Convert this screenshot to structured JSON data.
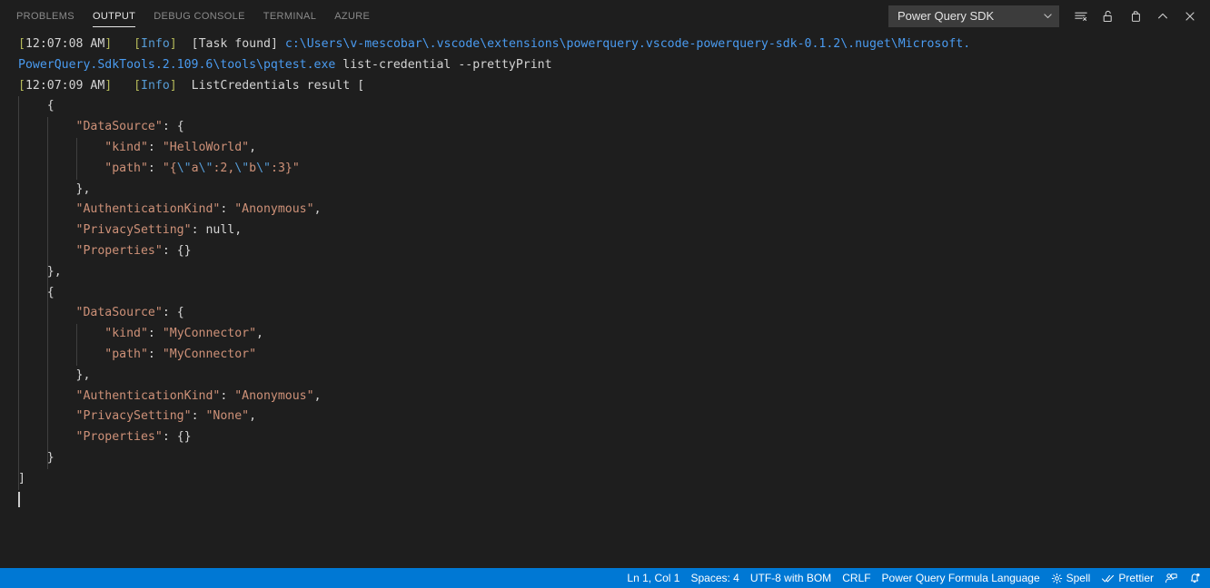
{
  "panel": {
    "tabs": [
      {
        "label": "PROBLEMS",
        "active": false
      },
      {
        "label": "OUTPUT",
        "active": true
      },
      {
        "label": "DEBUG CONSOLE",
        "active": false
      },
      {
        "label": "TERMINAL",
        "active": false
      },
      {
        "label": "AZURE",
        "active": false
      }
    ],
    "channel": {
      "value": "Power Query SDK",
      "chevron_icon": "chevron-down-icon"
    },
    "actions": [
      {
        "name": "clear-output-button",
        "icon": "clear-output-icon",
        "title": "Clear Output"
      },
      {
        "name": "turn-auto-scrolling-off-button",
        "icon": "unlock-icon",
        "title": "Turn Auto Scrolling Off"
      },
      {
        "name": "open-output-in-editor-button",
        "icon": "open-in-editor-icon",
        "title": "Open Output in Editor"
      },
      {
        "name": "maximize-panel-size-button",
        "icon": "chevron-up-icon",
        "title": "Maximize Panel Size"
      },
      {
        "name": "close-panel-button",
        "icon": "close-icon",
        "title": "Close Panel"
      }
    ]
  },
  "output": {
    "log_lines": [
      {
        "segments": [
          {
            "text": "[",
            "type": "bracket"
          },
          {
            "text": "12:07:08 AM",
            "type": "plain"
          },
          {
            "text": "]",
            "type": "bracket"
          },
          {
            "text": "   ",
            "type": "plain"
          },
          {
            "text": "[",
            "type": "bracket"
          },
          {
            "text": "Info",
            "type": "info"
          },
          {
            "text": "]",
            "type": "bracket"
          },
          {
            "text": "  ",
            "type": "plain"
          },
          {
            "text": "[Task found]",
            "type": "plain"
          },
          {
            "text": " ",
            "type": "plain"
          },
          {
            "text": "c:\\Users\\v-mescobar\\.vscode\\extensions\\powerquery.vscode-powerquery-sdk-0.1.2\\.nuget\\Microsoft.",
            "type": "path"
          }
        ]
      },
      {
        "segments": [
          {
            "text": "PowerQuery.SdkTools.2.109.6\\tools\\pqtest.exe",
            "type": "path"
          },
          {
            "text": " list-credential --prettyPrint",
            "type": "plain"
          }
        ]
      },
      {
        "segments": [
          {
            "text": "[",
            "type": "bracket"
          },
          {
            "text": "12:07:09 AM",
            "type": "plain"
          },
          {
            "text": "]",
            "type": "bracket"
          },
          {
            "text": "   ",
            "type": "plain"
          },
          {
            "text": "[",
            "type": "bracket"
          },
          {
            "text": "Info",
            "type": "info"
          },
          {
            "text": "]",
            "type": "bracket"
          },
          {
            "text": "  ",
            "type": "plain"
          },
          {
            "text": "ListCredentials result [",
            "type": "plain"
          }
        ]
      },
      {
        "segments": [
          {
            "text": "    {",
            "type": "punc"
          }
        ]
      },
      {
        "segments": [
          {
            "text": "        ",
            "type": "punc"
          },
          {
            "text": "\"DataSource\"",
            "type": "key"
          },
          {
            "text": ": {",
            "type": "punc"
          }
        ]
      },
      {
        "segments": [
          {
            "text": "            ",
            "type": "punc"
          },
          {
            "text": "\"kind\"",
            "type": "key"
          },
          {
            "text": ": ",
            "type": "punc"
          },
          {
            "text": "\"HelloWorld\"",
            "type": "str"
          },
          {
            "text": ",",
            "type": "punc"
          }
        ]
      },
      {
        "segments": [
          {
            "text": "            ",
            "type": "punc"
          },
          {
            "text": "\"path\"",
            "type": "key"
          },
          {
            "text": ": ",
            "type": "punc"
          },
          {
            "text": "\"{",
            "type": "str"
          },
          {
            "text": "\\\"",
            "type": "esc"
          },
          {
            "text": "a",
            "type": "str"
          },
          {
            "text": "\\\"",
            "type": "esc"
          },
          {
            "text": ":2,",
            "type": "str"
          },
          {
            "text": "\\\"",
            "type": "esc"
          },
          {
            "text": "b",
            "type": "str"
          },
          {
            "text": "\\\"",
            "type": "esc"
          },
          {
            "text": ":3}\"",
            "type": "str"
          }
        ]
      },
      {
        "segments": [
          {
            "text": "        },",
            "type": "punc"
          }
        ]
      },
      {
        "segments": [
          {
            "text": "        ",
            "type": "punc"
          },
          {
            "text": "\"AuthenticationKind\"",
            "type": "key"
          },
          {
            "text": ": ",
            "type": "punc"
          },
          {
            "text": "\"Anonymous\"",
            "type": "str"
          },
          {
            "text": ",",
            "type": "punc"
          }
        ]
      },
      {
        "segments": [
          {
            "text": "        ",
            "type": "punc"
          },
          {
            "text": "\"PrivacySetting\"",
            "type": "key"
          },
          {
            "text": ": ",
            "type": "punc"
          },
          {
            "text": "null",
            "type": "null"
          },
          {
            "text": ",",
            "type": "punc"
          }
        ]
      },
      {
        "segments": [
          {
            "text": "        ",
            "type": "punc"
          },
          {
            "text": "\"Properties\"",
            "type": "key"
          },
          {
            "text": ": {}",
            "type": "punc"
          }
        ]
      },
      {
        "segments": [
          {
            "text": "    },",
            "type": "punc"
          }
        ]
      },
      {
        "segments": [
          {
            "text": "    {",
            "type": "punc"
          }
        ]
      },
      {
        "segments": [
          {
            "text": "        ",
            "type": "punc"
          },
          {
            "text": "\"DataSource\"",
            "type": "key"
          },
          {
            "text": ": {",
            "type": "punc"
          }
        ]
      },
      {
        "segments": [
          {
            "text": "            ",
            "type": "punc"
          },
          {
            "text": "\"kind\"",
            "type": "key"
          },
          {
            "text": ": ",
            "type": "punc"
          },
          {
            "text": "\"MyConnector\"",
            "type": "str"
          },
          {
            "text": ",",
            "type": "punc"
          }
        ]
      },
      {
        "segments": [
          {
            "text": "            ",
            "type": "punc"
          },
          {
            "text": "\"path\"",
            "type": "key"
          },
          {
            "text": ": ",
            "type": "punc"
          },
          {
            "text": "\"MyConnector\"",
            "type": "str"
          }
        ]
      },
      {
        "segments": [
          {
            "text": "        },",
            "type": "punc"
          }
        ]
      },
      {
        "segments": [
          {
            "text": "        ",
            "type": "punc"
          },
          {
            "text": "\"AuthenticationKind\"",
            "type": "key"
          },
          {
            "text": ": ",
            "type": "punc"
          },
          {
            "text": "\"Anonymous\"",
            "type": "str"
          },
          {
            "text": ",",
            "type": "punc"
          }
        ]
      },
      {
        "segments": [
          {
            "text": "        ",
            "type": "punc"
          },
          {
            "text": "\"PrivacySetting\"",
            "type": "key"
          },
          {
            "text": ": ",
            "type": "punc"
          },
          {
            "text": "\"None\"",
            "type": "str"
          },
          {
            "text": ",",
            "type": "punc"
          }
        ]
      },
      {
        "segments": [
          {
            "text": "        ",
            "type": "punc"
          },
          {
            "text": "\"Properties\"",
            "type": "key"
          },
          {
            "text": ": {}",
            "type": "punc"
          }
        ]
      },
      {
        "segments": [
          {
            "text": "    }",
            "type": "punc"
          }
        ]
      },
      {
        "segments": [
          {
            "text": "]",
            "type": "punc"
          }
        ]
      },
      {
        "segments": []
      }
    ]
  },
  "status_bar": {
    "items": [
      {
        "name": "editor-position",
        "label": "Ln 1, Col 1",
        "icon": null
      },
      {
        "name": "editor-indentation",
        "label": "Spaces: 4",
        "icon": null
      },
      {
        "name": "editor-encoding",
        "label": "UTF-8 with BOM",
        "icon": null
      },
      {
        "name": "editor-eol",
        "label": "CRLF",
        "icon": null
      },
      {
        "name": "editor-language",
        "label": "Power Query Formula Language",
        "icon": null
      },
      {
        "name": "spell-checker",
        "label": "Spell",
        "icon": "gear-icon"
      },
      {
        "name": "prettier",
        "label": "Prettier",
        "icon": "double-check-icon"
      },
      {
        "name": "feedback",
        "label": "",
        "icon": "feedback-person-icon"
      },
      {
        "name": "notifications",
        "label": "",
        "icon": "bell-dot-icon"
      }
    ]
  },
  "colors": {
    "panel_background": "#1e1e1e",
    "status_bar_background": "#0078d4",
    "accent_text": "#ffffff",
    "json_key": "#ce9178",
    "json_string": "#ce9178",
    "log_info": "#569cd6",
    "log_path": "#4a9bf0",
    "log_timestamp_bracket": "#b5ba5a",
    "indent_guide": "#404040"
  }
}
